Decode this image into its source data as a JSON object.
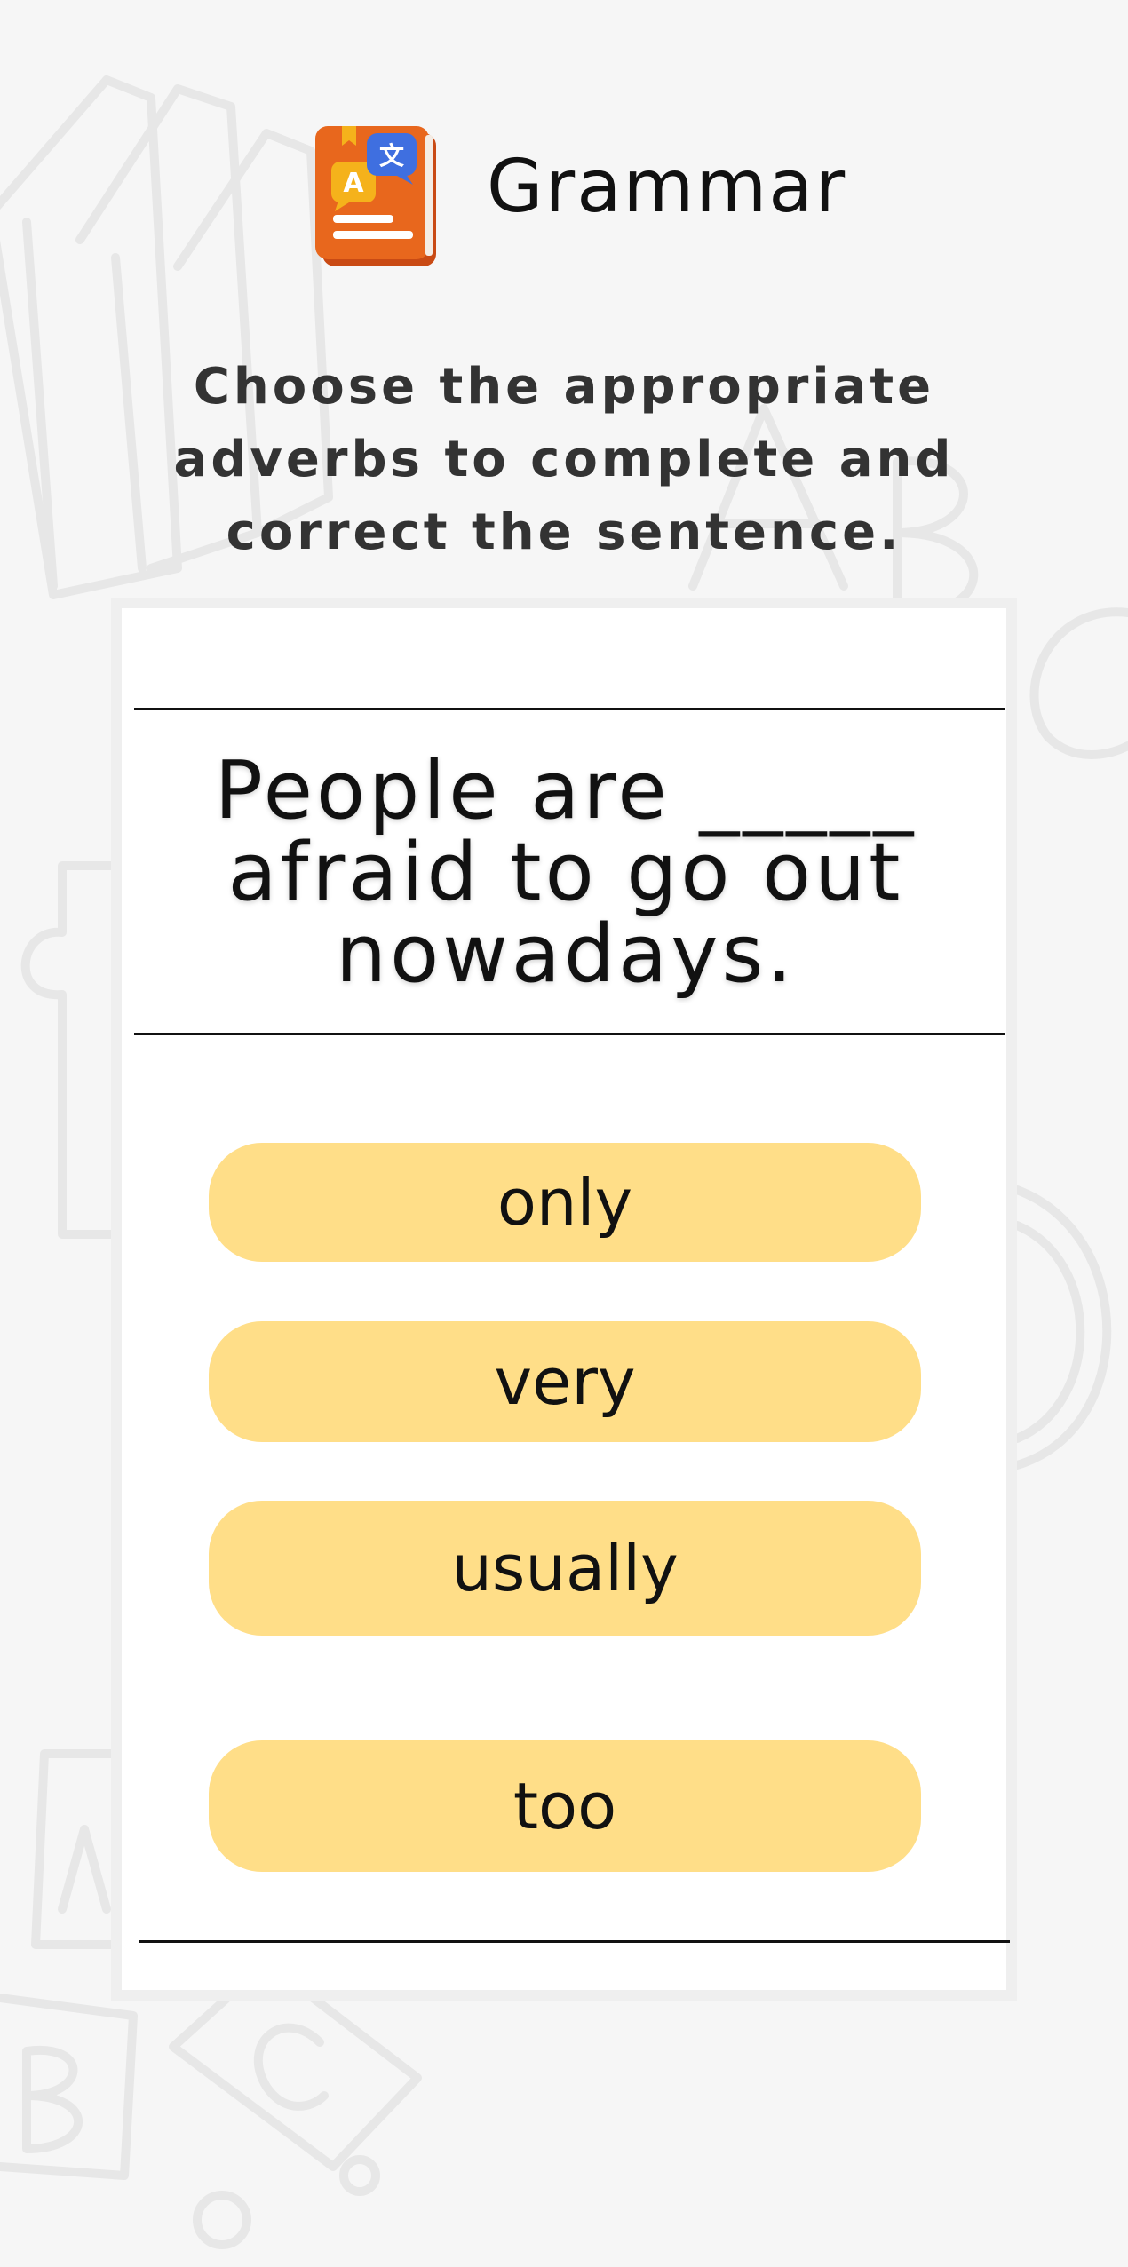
{
  "header": {
    "title": "Grammar",
    "icon": "grammar-book-icon"
  },
  "instruction": {
    "line1": "Choose the appropriate",
    "line2": "adverbs to complete and",
    "line3": "correct the sentence."
  },
  "question": {
    "line1": "People are _____",
    "line2": "afraid to go out",
    "line3": "nowadays."
  },
  "options": [
    {
      "label": "only"
    },
    {
      "label": "very"
    },
    {
      "label": "usually"
    },
    {
      "label": "too"
    }
  ],
  "colors": {
    "background": "#f6f6f6",
    "card": "#ffffff",
    "option": "#ffde88",
    "icon_book": "#e8671d",
    "icon_bubble_yellow": "#f5b21b",
    "icon_bubble_blue": "#3f6fe0"
  }
}
